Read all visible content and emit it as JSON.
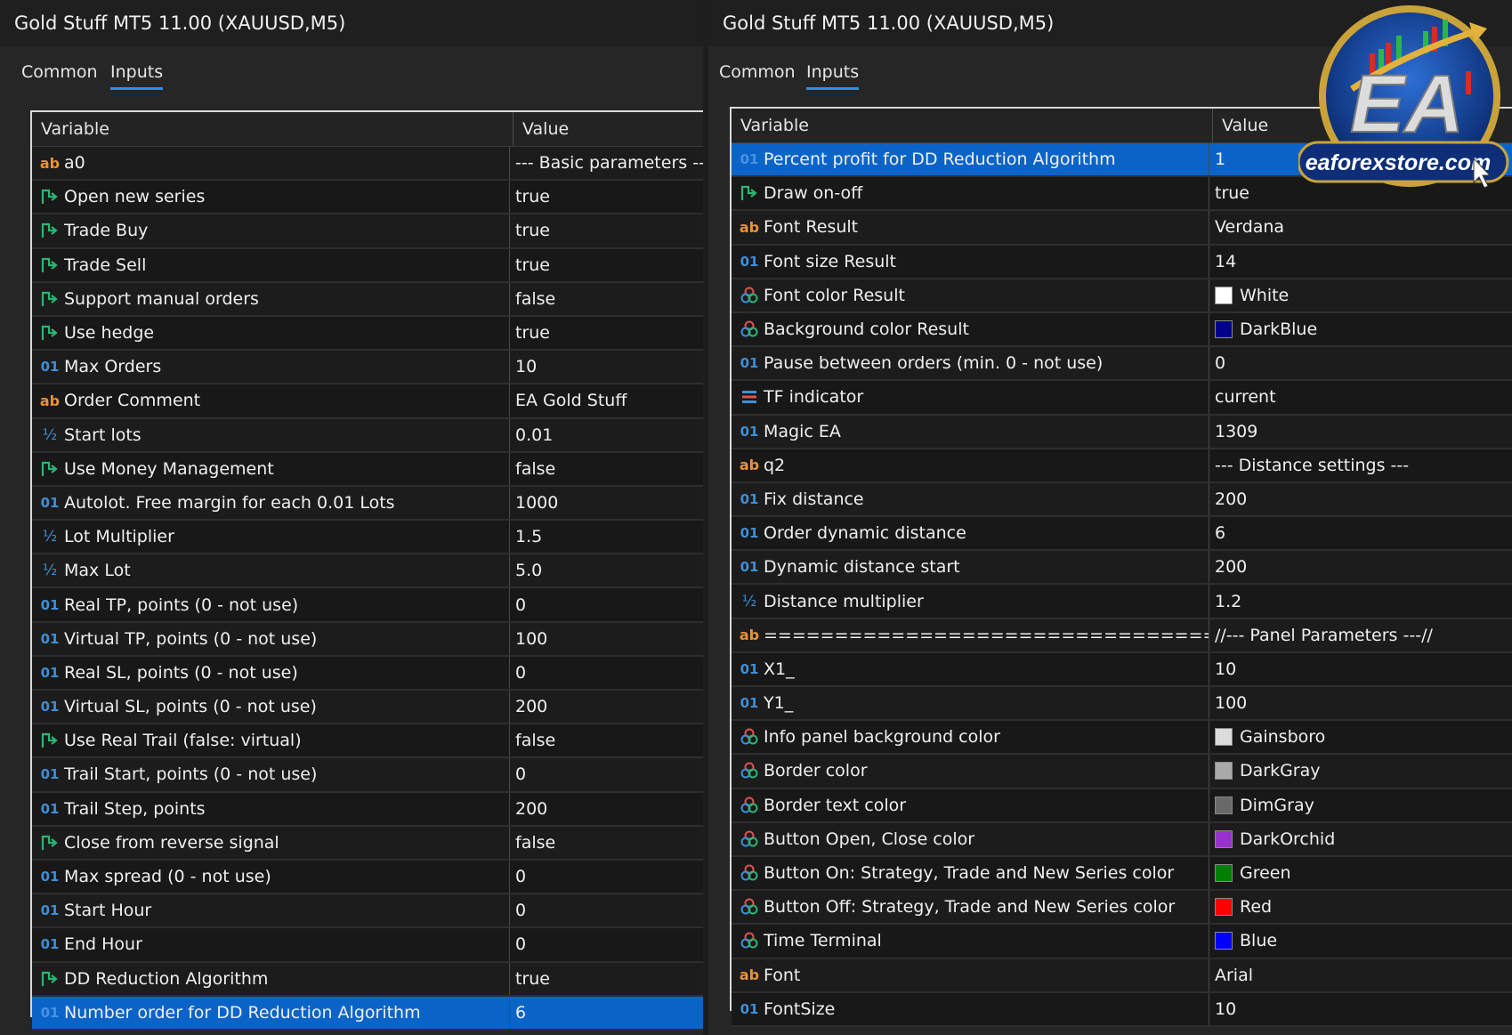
{
  "left": {
    "title": "Gold Stuff MT5 11.00 (XAUUSD,M5)",
    "tabs": [
      {
        "label": "Common"
      },
      {
        "label": "Inputs"
      }
    ],
    "header": {
      "variable": "Variable",
      "value": "Value"
    },
    "rows": [
      {
        "icon": "ab",
        "variable": "a0",
        "value": "--- Basic parameters ---"
      },
      {
        "icon": "bool",
        "variable": "Open new series",
        "value": "true"
      },
      {
        "icon": "bool",
        "variable": "Trade Buy",
        "value": "true"
      },
      {
        "icon": "bool",
        "variable": "Trade Sell",
        "value": "true"
      },
      {
        "icon": "bool",
        "variable": "Support manual orders",
        "value": "false"
      },
      {
        "icon": "bool",
        "variable": "Use hedge",
        "value": "true"
      },
      {
        "icon": "01",
        "variable": "Max Orders",
        "value": "10"
      },
      {
        "icon": "ab",
        "variable": "Order Comment",
        "value": "EA Gold Stuff"
      },
      {
        "icon": "half",
        "variable": "Start lots",
        "value": "0.01"
      },
      {
        "icon": "bool",
        "variable": "Use Money Management",
        "value": "false"
      },
      {
        "icon": "01",
        "variable": "Autolot. Free margin for each 0.01 Lots",
        "value": "1000"
      },
      {
        "icon": "half",
        "variable": "Lot Multiplier",
        "value": "1.5"
      },
      {
        "icon": "half",
        "variable": "Max Lot",
        "value": "5.0"
      },
      {
        "icon": "01",
        "variable": "Real TP, points (0 - not use)",
        "value": "0"
      },
      {
        "icon": "01",
        "variable": "Virtual TP, points (0 - not use)",
        "value": "100"
      },
      {
        "icon": "01",
        "variable": "Real SL, points (0 - not use)",
        "value": "0"
      },
      {
        "icon": "01",
        "variable": "Virtual SL, points (0 - not use)",
        "value": "200"
      },
      {
        "icon": "bool",
        "variable": "Use Real Trail (false: virtual)",
        "value": "false"
      },
      {
        "icon": "01",
        "variable": "Trail Start, points (0 - not use)",
        "value": "0"
      },
      {
        "icon": "01",
        "variable": "Trail Step, points",
        "value": "200"
      },
      {
        "icon": "bool",
        "variable": "Close from reverse signal",
        "value": "false"
      },
      {
        "icon": "01",
        "variable": "Max spread (0 - not use)",
        "value": "0"
      },
      {
        "icon": "01",
        "variable": "Start Hour",
        "value": "0"
      },
      {
        "icon": "01",
        "variable": "End Hour",
        "value": "0"
      },
      {
        "icon": "bool",
        "variable": "DD Reduction Algorithm",
        "value": "true"
      },
      {
        "icon": "01",
        "variable": "Number order for DD Reduction Algorithm",
        "value": "6",
        "selected": true
      }
    ]
  },
  "right": {
    "title": "Gold Stuff MT5 11.00 (XAUUSD,M5)",
    "tabs": [
      {
        "label": "Common"
      },
      {
        "label": "Inputs"
      }
    ],
    "header": {
      "variable": "Variable",
      "value": "Value"
    },
    "rows": [
      {
        "icon": "01",
        "variable": "Percent profit for DD Reduction Algorithm",
        "value": "1",
        "selected": true
      },
      {
        "icon": "bool",
        "variable": "Draw on-off",
        "value": "true"
      },
      {
        "icon": "ab",
        "variable": "Font Result",
        "value": "Verdana"
      },
      {
        "icon": "01",
        "variable": "Font size Result",
        "value": "14"
      },
      {
        "icon": "color",
        "variable": "Font color Result",
        "value": "White",
        "swatch": "#ffffff"
      },
      {
        "icon": "color",
        "variable": "Background color Result",
        "value": "DarkBlue",
        "swatch": "#00008b"
      },
      {
        "icon": "01",
        "variable": "Pause between orders (min. 0 - not use)",
        "value": "0"
      },
      {
        "icon": "enum",
        "variable": "TF indicator",
        "value": "current"
      },
      {
        "icon": "01",
        "variable": "Magic EA",
        "value": "1309"
      },
      {
        "icon": "ab",
        "variable": "q2",
        "value": "--- Distance settings ---"
      },
      {
        "icon": "01",
        "variable": "Fix distance",
        "value": "200"
      },
      {
        "icon": "01",
        "variable": "Order dynamic distance",
        "value": "6"
      },
      {
        "icon": "01",
        "variable": "Dynamic distance start",
        "value": "200"
      },
      {
        "icon": "half",
        "variable": "Distance multiplier",
        "value": "1.2"
      },
      {
        "icon": "ab",
        "variable": "================================...",
        "value": "//--- Panel Parameters ---//"
      },
      {
        "icon": "01",
        "variable": "X1_",
        "value": "10"
      },
      {
        "icon": "01",
        "variable": "Y1_",
        "value": "100"
      },
      {
        "icon": "color",
        "variable": "Info panel background color",
        "value": "Gainsboro",
        "swatch": "#dcdcdc"
      },
      {
        "icon": "color",
        "variable": "Border color",
        "value": "DarkGray",
        "swatch": "#a9a9a9"
      },
      {
        "icon": "color",
        "variable": "Border text color",
        "value": "DimGray",
        "swatch": "#696969"
      },
      {
        "icon": "color",
        "variable": "Button Open, Close color",
        "value": "DarkOrchid",
        "swatch": "#9932cc"
      },
      {
        "icon": "color",
        "variable": "Button On: Strategy, Trade and New Series color",
        "value": "Green",
        "swatch": "#008000"
      },
      {
        "icon": "color",
        "variable": "Button Off: Strategy, Trade and New Series color",
        "value": "Red",
        "swatch": "#ff0000"
      },
      {
        "icon": "color",
        "variable": "Time Terminal",
        "value": "Blue",
        "swatch": "#0000ff"
      },
      {
        "icon": "ab",
        "variable": "Font",
        "value": "Arial"
      },
      {
        "icon": "01",
        "variable": "FontSize",
        "value": "10"
      }
    ]
  },
  "logo": {
    "text": "EA",
    "url_text": "eaforexstore.com"
  },
  "colors": {
    "selection": "#0a64c8",
    "tab_underline": "#2f8fe6",
    "ab_icon": "#e8913a",
    "num_icon": "#3d8fd9",
    "bool_icon": "#2bb673"
  }
}
